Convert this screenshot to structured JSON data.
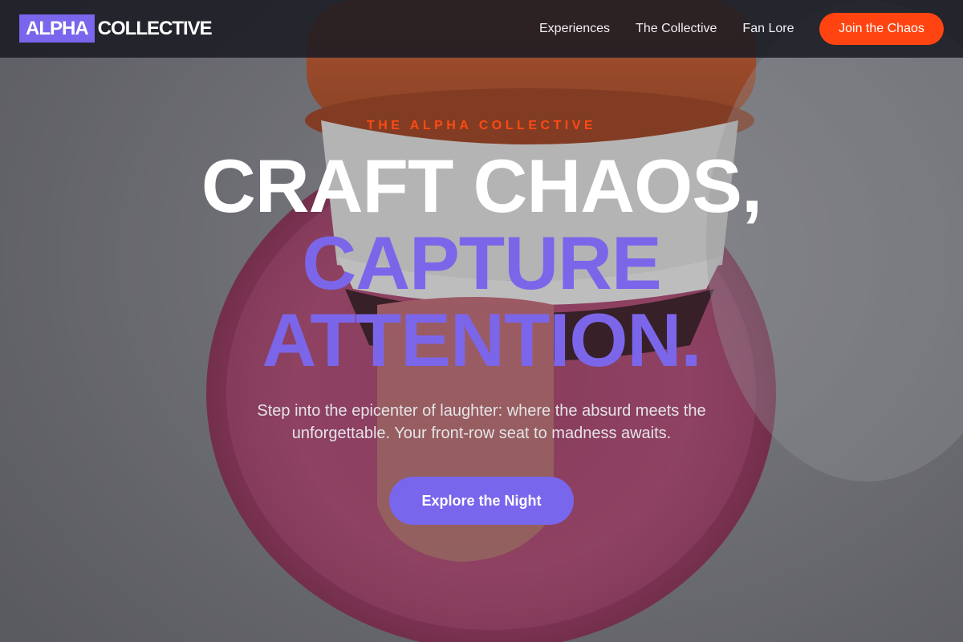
{
  "brand": {
    "box": "ALPHA",
    "text": "COLLECTIVE"
  },
  "nav": {
    "links": [
      "Experiences",
      "The Collective",
      "Fan Lore"
    ],
    "cta": "Join the Chaos"
  },
  "hero": {
    "eyebrow": "THE ALPHA COLLECTIVE",
    "headline": {
      "line1": "CRAFT CHAOS,",
      "line2": "CAPTURE",
      "line3": "ATTENTION."
    },
    "subtext": "Step into the epicenter of laughter: where the absurd meets the unforgettable. Your front-row seat to madness awaits.",
    "cta": "Explore the Night"
  },
  "colors": {
    "accent_purple": "#7866ec",
    "accent_orange": "#ff4411",
    "navbar_bg": "#181a22"
  }
}
